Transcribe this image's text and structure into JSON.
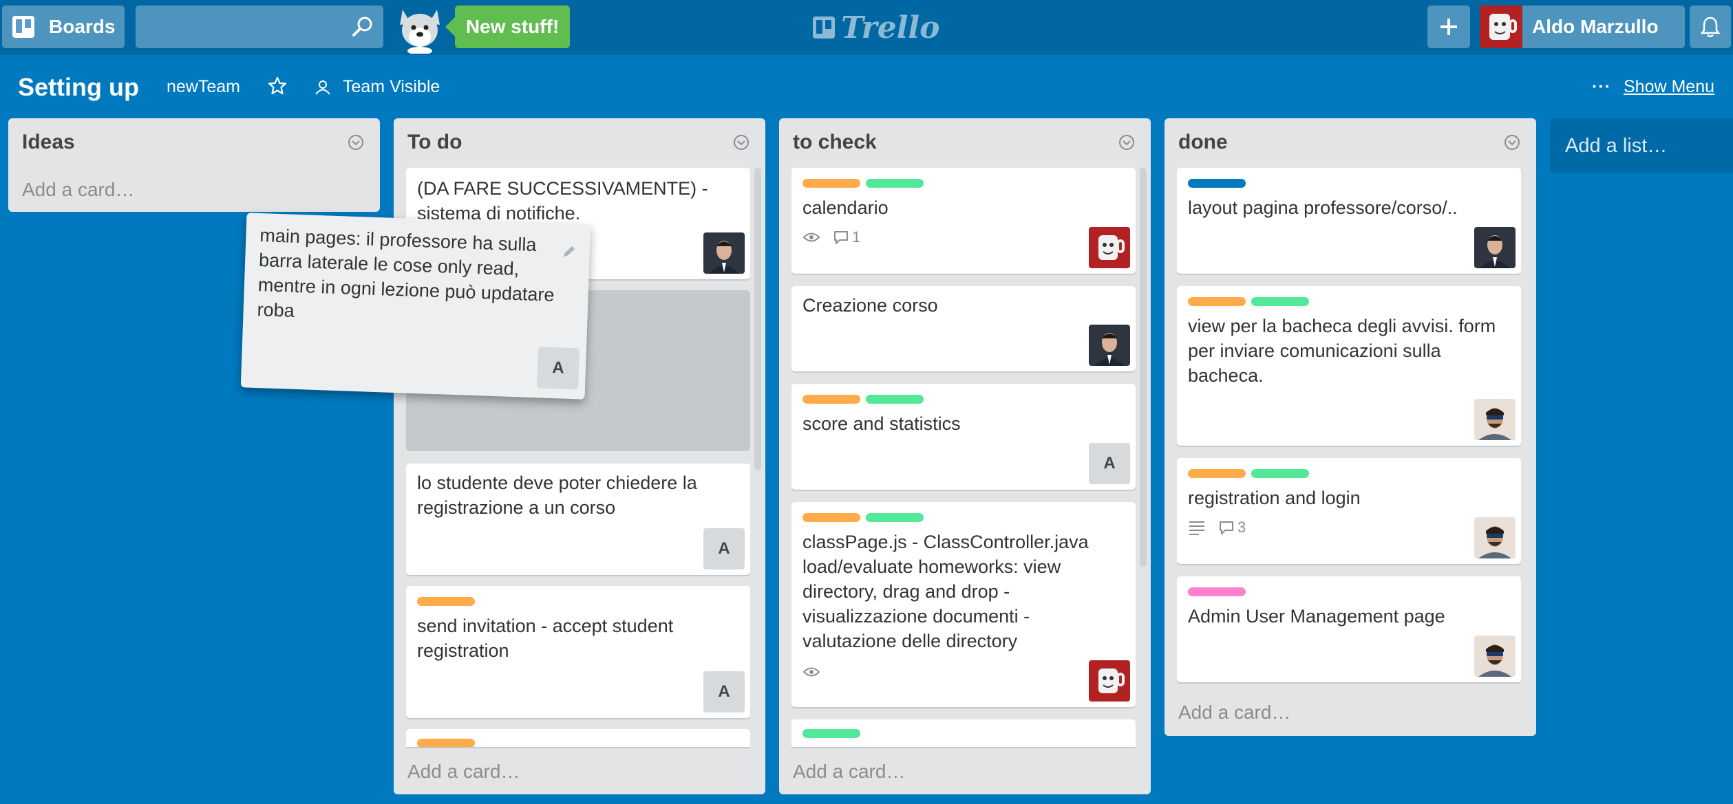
{
  "header": {
    "boards_label": "Boards",
    "new_stuff_label": "New stuff!",
    "logo_text": "Trello",
    "user_name": "Aldo Marzullo"
  },
  "board": {
    "title": "Setting up",
    "team": "newTeam",
    "visibility": "Team Visible",
    "menu_label": "Show Menu"
  },
  "lists": {
    "ideas": {
      "title": "Ideas",
      "add_card": "Add a card…"
    },
    "todo": {
      "title": "To do",
      "add_card": "Add a card…",
      "cards": [
        {
          "text": "(DA FARE SUCCESSIVAMENTE) - sistema di notifiche."
        },
        {
          "text": "lo studente deve poter chiedere la registrazione a un corso",
          "member": "A"
        },
        {
          "text": "send invitation - accept student registration",
          "member": "A"
        }
      ]
    },
    "tocheck": {
      "title": "to check",
      "add_card": "Add a card…",
      "cards": [
        {
          "text": "calendario",
          "comments": "1"
        },
        {
          "text": "Creazione corso"
        },
        {
          "text": "score and statistics",
          "member": "A"
        },
        {
          "text": "classPage.js - ClassController.java load/evaluate homeworks: view directory, drag and drop - visualizzazione documenti - valutazione delle directory"
        }
      ]
    },
    "done": {
      "title": "done",
      "add_card": "Add a card…",
      "cards": [
        {
          "text": "layout pagina professore/corso/.."
        },
        {
          "text": "view per la bacheca degli avvisi. form per inviare comunicazioni sulla bacheca."
        },
        {
          "text": "registration and login",
          "comments": "3"
        },
        {
          "text": "Admin User Management page"
        }
      ]
    }
  },
  "add_list": "Add a list…",
  "dragging_card": {
    "text": "main pages: il professore ha sulla barra laterale le cose only read, mentre in ogni lezione può updatare roba",
    "member": "A"
  },
  "colors": {
    "board_bg": "#0079bf",
    "label_orange": "#ffab4a",
    "label_green": "#51e898",
    "label_blue": "#0079bf",
    "label_pink": "#ff80ce"
  }
}
